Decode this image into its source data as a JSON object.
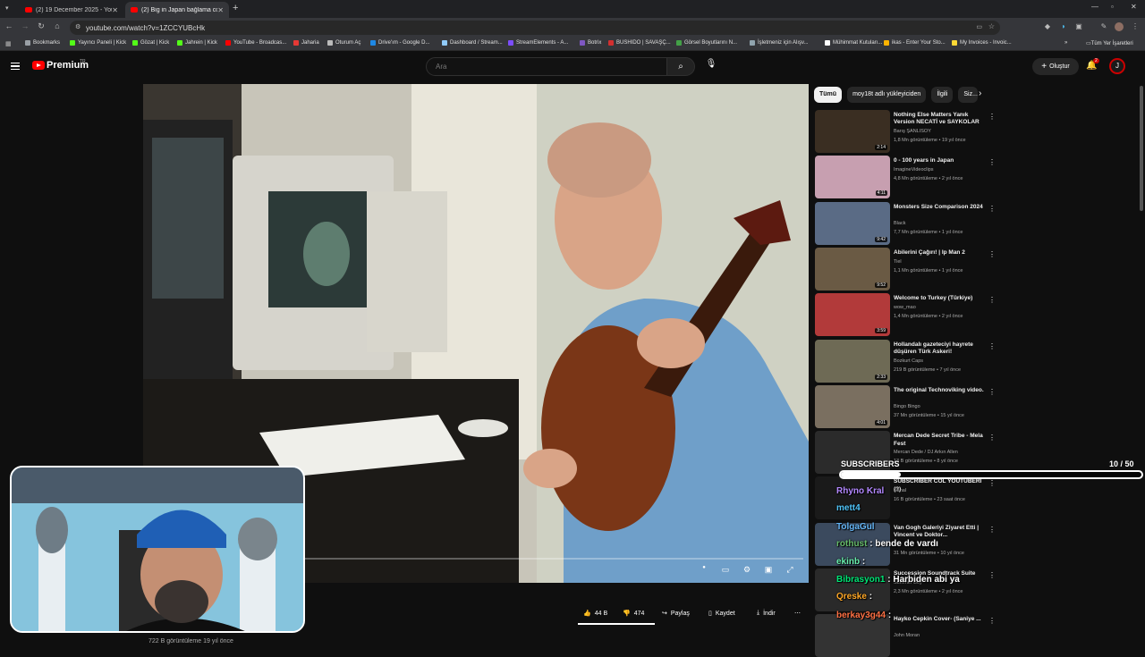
{
  "browser": {
    "tabs": [
      {
        "title": "(2) 19 December 2025 - YouTub"
      },
      {
        "title": "(2) Big in Japan bağlama cover"
      }
    ],
    "url": "youtube.com/watch?v=1ZCCYUBcHk",
    "bookmarks": [
      {
        "label": "Bookmarks",
        "color": "#9aa0a6"
      },
      {
        "label": "Yayıncı Paneli | Kick",
        "color": "#53fc18"
      },
      {
        "label": "Gözat | Kick",
        "color": "#53fc18"
      },
      {
        "label": "Jahrein | Kick",
        "color": "#53fc18"
      },
      {
        "label": "YouTube - Broadcas...",
        "color": "#ff0000"
      },
      {
        "label": "Jaharia",
        "color": "#e53935"
      },
      {
        "label": "Oturum Aç",
        "color": "#bbbbbb"
      },
      {
        "label": "Drive'ım - Google D...",
        "color": "#1e88e5"
      },
      {
        "label": "Dashboard / Stream...",
        "color": "#90caf9"
      },
      {
        "label": "StreamElements - A...",
        "color": "#7c4dff"
      },
      {
        "label": "Botrix",
        "color": "#7e57c2"
      },
      {
        "label": "BUSHIDO | SAVAŞÇ...",
        "color": "#d32f2f"
      },
      {
        "label": "Görsel Boyutlarını N...",
        "color": "#43a047"
      },
      {
        "label": "İşletmeniz için Alışv...",
        "color": "#90a4ae"
      },
      {
        "label": "Mühimmat Kutuları...",
        "color": "#ffffff"
      },
      {
        "label": "ikas - Enter Your Sto...",
        "color": "#ffb300"
      },
      {
        "label": "My Invoices - Invoic...",
        "color": "#fdd835"
      }
    ],
    "all_bookmarks": "Tüm Yer İşaretleri"
  },
  "header": {
    "logo": "Premium",
    "region": "TR",
    "search_placeholder": "Ara",
    "create": "Oluştur",
    "notifications": "2",
    "avatar_letter": "J"
  },
  "video": {
    "likes": "44 B",
    "dislikes": "474",
    "share": "Paylaş",
    "save": "Kaydet",
    "download": "İndir",
    "views": "722 B görüntüleme  19 yıl önce"
  },
  "chips": [
    "Tümü",
    "moy18t adlı yükleyiciden",
    "İlgili",
    "Siz..."
  ],
  "recommendations": [
    {
      "title": "Nothing Else Matters Yanık Version NECATİ ve SAYKOLAR",
      "channel": "Barış ŞANLISOY",
      "meta": "1,8 Mn görüntüleme • 19 yıl önce",
      "duration": "2:14",
      "thumb": "#3a2e22"
    },
    {
      "title": "0 - 100 years in Japan",
      "channel": "ImagineVideoclips",
      "meta": "4,8 Mn görüntüleme • 2 yıl önce",
      "duration": "4:11",
      "thumb": "#c79fb0"
    },
    {
      "title": "Monsters Size Comparison 2024",
      "channel": "Black",
      "meta": "7,7 Mn görüntüleme • 1 yıl önce",
      "duration": "9:42",
      "thumb": "#5a6b85"
    },
    {
      "title": "Abilerini Çağırı! | Ip Man 2",
      "channel": "Tiel",
      "meta": "1,1 Mn görüntüleme • 1 yıl önce",
      "duration": "9:52",
      "thumb": "#6a5a44"
    },
    {
      "title": "Welcome to Turkey (Türkiye)",
      "channel": "wow_mao",
      "meta": "1,4 Mn görüntüleme • 2 yıl önce",
      "duration": "3:59",
      "thumb": "#b23a3a"
    },
    {
      "title": "Hollandalı gazeteciyi hayrete düşüren Türk Askeri!",
      "channel": "Bozkurt Caps",
      "meta": "219 B görüntüleme • 7 yıl önce",
      "duration": "2:33",
      "thumb": "#6e6a55"
    },
    {
      "title": "The original Technoviking video.",
      "channel": "Bingo Bingo",
      "meta": "37 Mn görüntüleme • 15 yıl önce",
      "duration": "4:01",
      "thumb": "#7a6f60"
    },
    {
      "title": "Mercan Dede Secret Tribe - Mela Fest",
      "channel": "Mercan Dede / DJ Arkın Allen",
      "meta": "13 B görüntüleme • 8 yıl önce",
      "duration": "",
      "thumb": "#2b2b2b"
    },
    {
      "title": "SUBSCRIBER COL YOUTUBERI (?)",
      "channel": "Kanal",
      "meta": "16 B görüntüleme • 23 saat önce",
      "duration": "",
      "thumb": "#1a1a1a"
    },
    {
      "title": "Van Gogh Galeriyi Ziyaret Etti | Vincent ve Doktor...",
      "channel": "",
      "meta": "31 Mn görüntüleme • 10 yıl önce",
      "duration": "",
      "thumb": "#3b4a5e"
    },
    {
      "title": "Succession Soundtrack Suite",
      "channel": "Summer Boy",
      "meta": "2,3 Mn görüntüleme • 2 yıl önce",
      "duration": "",
      "thumb": "#2a2a2a"
    },
    {
      "title": "Hayko Cepkin Cover- (Saniye ...",
      "channel": "John Moran",
      "meta": "",
      "duration": "",
      "thumb": "#333333"
    }
  ],
  "overlay": {
    "subs_label": "SUBSCRIBERS",
    "subs_count": "10  /  50",
    "subs_progress": 0.2,
    "chat": [
      {
        "user": "Rhyno Kral",
        "msg": "",
        "color": "#b388ff"
      },
      {
        "user": "mett4",
        "msg": "",
        "color": "#4fc3f7"
      },
      {
        "user": "TolgaGul",
        "msg": "",
        "color": "#64b5f6"
      },
      {
        "user": "rothust",
        "msg": ": bende de vardı",
        "color": "#66bb6a"
      },
      {
        "user": "ekinb",
        "msg": ":",
        "color": "#69f0ae"
      },
      {
        "user": "Bibrasyon1",
        "msg": ": Harbiden abi ya",
        "color": "#00e676"
      },
      {
        "user": "Qreske",
        "msg": ":",
        "color": "#ffa726"
      },
      {
        "user": "berkay3g44",
        "msg": ":",
        "color": "#ff7043"
      }
    ]
  }
}
